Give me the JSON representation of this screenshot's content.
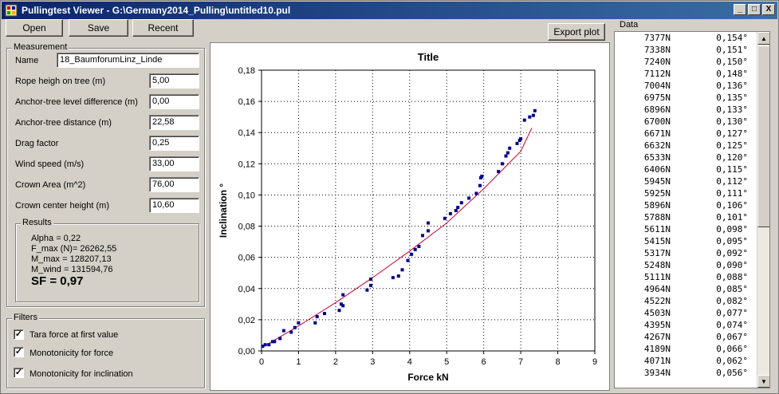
{
  "window": {
    "title": "Pullingtest Viewer - G:\\Germany2014_Pulling\\untitled10.pul",
    "min": "_",
    "max": "□",
    "close": "X"
  },
  "toolbar": {
    "open": "Open",
    "save": "Save",
    "recent": "Recent",
    "export": "Export plot"
  },
  "measurement": {
    "group_label": "Measurement",
    "fields": [
      {
        "label": "Name",
        "value": "18_BaumforumLinz_Linde"
      },
      {
        "label": "Rope heigh on tree (m)",
        "value": "5,00"
      },
      {
        "label": "Anchor-tree level difference (m)",
        "value": "0,00"
      },
      {
        "label": "Anchor-tree distance (m)",
        "value": "22,58"
      },
      {
        "label": "Drag factor",
        "value": "0,25"
      },
      {
        "label": "Wind speed (m/s)",
        "value": "33,00"
      },
      {
        "label": "Crown Area (m^2)",
        "value": "76,00"
      },
      {
        "label": "Crown center height (m)",
        "value": "10,60"
      }
    ]
  },
  "results": {
    "group_label": "Results",
    "lines": [
      "Alpha = 0,22",
      "F_max (N)= 26262,55",
      "M_max = 128207,13",
      "M_wind = 131594,76"
    ],
    "sf": "SF = 0,97"
  },
  "filters": {
    "group_label": "Filters",
    "items": [
      {
        "label": "Tara force at first value",
        "checked": true,
        "mark": "✓"
      },
      {
        "label": "Monotonicity for force",
        "checked": true,
        "mark": "✓"
      },
      {
        "label": "Monotonicity for inclination",
        "checked": true,
        "mark": "✓"
      }
    ]
  },
  "data_panel": {
    "group_label": "Data",
    "rows": [
      [
        "7377N",
        "0,154°"
      ],
      [
        "7338N",
        "0,151°"
      ],
      [
        "7240N",
        "0,150°"
      ],
      [
        "7112N",
        "0,148°"
      ],
      [
        "7004N",
        "0,136°"
      ],
      [
        "6975N",
        "0,135°"
      ],
      [
        "6896N",
        "0,133°"
      ],
      [
        "6700N",
        "0,130°"
      ],
      [
        "6671N",
        "0,127°"
      ],
      [
        "6632N",
        "0,125°"
      ],
      [
        "6533N",
        "0,120°"
      ],
      [
        "6406N",
        "0,115°"
      ],
      [
        "5945N",
        "0,112°"
      ],
      [
        "5925N",
        "0,111°"
      ],
      [
        "5896N",
        "0,106°"
      ],
      [
        "5788N",
        "0,101°"
      ],
      [
        "5611N",
        "0,098°"
      ],
      [
        "5415N",
        "0,095°"
      ],
      [
        "5317N",
        "0,092°"
      ],
      [
        "5248N",
        "0,090°"
      ],
      [
        "5111N",
        "0,088°"
      ],
      [
        "4964N",
        "0,085°"
      ],
      [
        "4522N",
        "0,082°"
      ],
      [
        "4503N",
        "0,077°"
      ],
      [
        "4395N",
        "0,074°"
      ],
      [
        "4267N",
        "0,067°"
      ],
      [
        "4189N",
        "0,066°"
      ],
      [
        "4071N",
        "0,062°"
      ],
      [
        "3934N",
        "0,056°"
      ]
    ],
    "scroll_up": "▲",
    "scroll_down": "▼"
  },
  "chart_data": {
    "type": "scatter",
    "title": "Title",
    "xlabel": "Force  kN",
    "ylabel": "Inclination  °",
    "xlim": [
      0,
      9
    ],
    "ylim": [
      0,
      0.18
    ],
    "xticks": [
      "0",
      "1",
      "2",
      "3",
      "4",
      "5",
      "6",
      "7",
      "8",
      "9"
    ],
    "yticks": [
      "0,00",
      "0,02",
      "0,04",
      "0,06",
      "0,08",
      "0,10",
      "0,12",
      "0,14",
      "0,16",
      "0,18"
    ],
    "grid": true,
    "point_color": "#00008b",
    "line_color": "#cc0033",
    "points": [
      [
        0.03,
        0.003
      ],
      [
        0.1,
        0.004
      ],
      [
        0.2,
        0.004
      ],
      [
        0.3,
        0.006
      ],
      [
        0.35,
        0.006
      ],
      [
        0.5,
        0.008
      ],
      [
        0.6,
        0.013
      ],
      [
        0.8,
        0.012
      ],
      [
        0.9,
        0.015
      ],
      [
        1.0,
        0.018
      ],
      [
        1.45,
        0.018
      ],
      [
        1.5,
        0.022
      ],
      [
        1.7,
        0.024
      ],
      [
        2.1,
        0.026
      ],
      [
        2.15,
        0.03
      ],
      [
        2.2,
        0.029
      ],
      [
        2.2,
        0.036
      ],
      [
        2.85,
        0.039
      ],
      [
        2.95,
        0.042
      ],
      [
        2.95,
        0.046
      ],
      [
        3.55,
        0.047
      ],
      [
        3.7,
        0.048
      ],
      [
        3.8,
        0.052
      ],
      [
        3.95,
        0.058
      ],
      [
        4.05,
        0.062
      ],
      [
        4.15,
        0.065
      ],
      [
        4.25,
        0.067
      ],
      [
        4.35,
        0.074
      ],
      [
        4.5,
        0.077
      ],
      [
        4.5,
        0.082
      ],
      [
        4.95,
        0.085
      ],
      [
        5.1,
        0.088
      ],
      [
        5.25,
        0.09
      ],
      [
        5.3,
        0.092
      ],
      [
        5.4,
        0.095
      ],
      [
        5.6,
        0.098
      ],
      [
        5.8,
        0.101
      ],
      [
        5.9,
        0.106
      ],
      [
        5.92,
        0.111
      ],
      [
        5.95,
        0.112
      ],
      [
        6.4,
        0.115
      ],
      [
        6.5,
        0.12
      ],
      [
        6.6,
        0.125
      ],
      [
        6.65,
        0.127
      ],
      [
        6.7,
        0.13
      ],
      [
        6.9,
        0.133
      ],
      [
        6.97,
        0.135
      ],
      [
        7.0,
        0.136
      ],
      [
        7.1,
        0.148
      ],
      [
        7.24,
        0.15
      ],
      [
        7.34,
        0.151
      ],
      [
        7.38,
        0.154
      ]
    ],
    "fit_line": [
      [
        0,
        0.002
      ],
      [
        1,
        0.016
      ],
      [
        2,
        0.031
      ],
      [
        3,
        0.047
      ],
      [
        4,
        0.064
      ],
      [
        5,
        0.082
      ],
      [
        6,
        0.104
      ],
      [
        7,
        0.128
      ],
      [
        7.3,
        0.143
      ]
    ]
  }
}
